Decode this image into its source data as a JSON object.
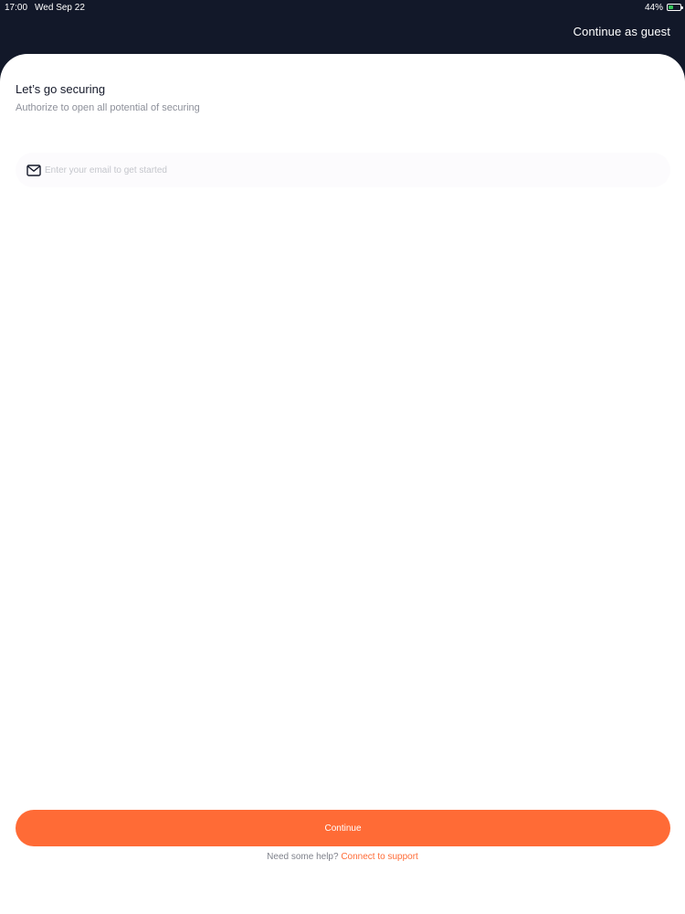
{
  "status_bar": {
    "time": "17:00",
    "date": "Wed Sep 22",
    "battery_text": "44%",
    "battery_level": 0.44
  },
  "header": {
    "guest_label": "Continue as guest"
  },
  "login": {
    "title": "Let’s go securing",
    "subtitle": "Authorize to open all potential of securing",
    "email_placeholder": "Enter your email to get started",
    "email_value": "",
    "continue_label": "Continue",
    "help_text": "Need some help?",
    "support_link": "Connect to support"
  },
  "icons": {
    "email": "mail-icon",
    "battery": "battery-icon"
  },
  "colors": {
    "header_bg": "#121829",
    "accent": "#ff6b36",
    "battery_fill": "#34c759",
    "title_text": "#15192a",
    "muted_text": "#8d909a"
  }
}
